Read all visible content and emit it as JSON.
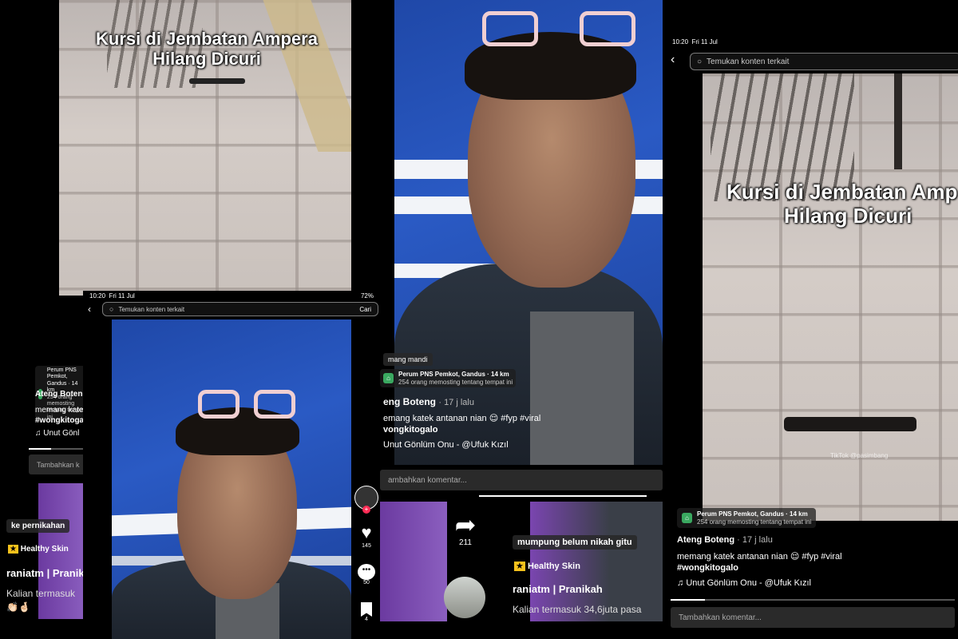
{
  "video_caption": {
    "line1": "Kursi di Jembatan Ampera",
    "line2": "Hilang Dicuri",
    "line1_cropped": "Kursi di Jembatan Amp"
  },
  "status_bar": {
    "time": "10:20",
    "date": "Fri 11 Jul",
    "battery": "72%"
  },
  "search": {
    "placeholder": "Temukan konten terkait",
    "button": "Cari"
  },
  "post": {
    "location_name": "Perum PNS Pemkot, Gandus · 14 km",
    "location_sub": "254 orang memosting tentang tempat ini",
    "author": "Ateng Boteng",
    "author_cropped": "Ateng Boteng",
    "author_cropped2": "eng Boteng",
    "time_ago": "· 17 j lalu",
    "caption": "memang katek antanan nian 😌 #fyp #viral",
    "caption_cropped": "memang katek",
    "caption_cropped2": "emang katek antanan nian 😌 #fyp #viral",
    "hashtag": "#wongkitogalo",
    "hashtag_cropped": "#wongkitoga",
    "hashtag_cropped2": "vongkitogalo",
    "music": "Unut Gönlüm Onu - @Ufuk Kızıl",
    "music_cropped": "Unut Gönl",
    "music_cropped2": "Unut Gönlüm Onu - @Ufuk Kızıl",
    "top_label": "mang mandi",
    "watermark": "TikTok @pasimbang"
  },
  "comment_placeholder": "Tambahkan komentar...",
  "comment_placeholder_cropped": "Tambahkan k",
  "comment_placeholder_cropped2": "ambahkan komentar...",
  "actions": {
    "likes": "145",
    "comments": "50",
    "saves": "4",
    "shares": "211"
  },
  "next_video": {
    "tag1": "ke pernikahan",
    "tag2": "mumpung belum nikah gitu",
    "product": "Healthy Skin",
    "account": "raniatm | Pranikah",
    "account_cropped": "raniatm | Pranikah",
    "text": "Kalian termasuk 34,6juta pasa",
    "text_cropped": "Kalian termasuk"
  },
  "colors": {
    "accent_red": "#fe2c55",
    "location_green": "#3aa860"
  }
}
